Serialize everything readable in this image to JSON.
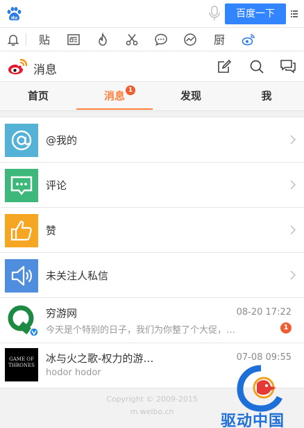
{
  "browser": {
    "search_button": "百度一下"
  },
  "header": {
    "title": "消息"
  },
  "tabs": [
    {
      "label": "首页"
    },
    {
      "label": "消息",
      "badge": "1"
    },
    {
      "label": "发现"
    },
    {
      "label": "我"
    }
  ],
  "list": [
    {
      "label": "@我的",
      "icon": "at-icon",
      "color": "#54b2d6"
    },
    {
      "label": "评论",
      "icon": "comment-icon",
      "color": "#3db87a"
    },
    {
      "label": "赞",
      "icon": "thumbs-up-icon",
      "color": "#f5a623"
    },
    {
      "label": "未关注人私信",
      "icon": "speaker-icon",
      "color": "#4f8ddf"
    }
  ],
  "messages": [
    {
      "name": "穷游网",
      "time": "08-20 17:22",
      "preview": "今天是个特别的日子，我们为你整了个大促，…",
      "badge": "1"
    },
    {
      "name": "冰与火之歌-权力的游…",
      "time": "07-08 09:55",
      "preview": "hodor hodor",
      "avatar_text": "GAME OF THRONES"
    }
  ],
  "footer": {
    "copyright": "Copyright © 2009-2015",
    "domain": "m.weibo.cn"
  },
  "watermark": {
    "text": "驱动中国"
  },
  "colors": {
    "accent": "#ff8140",
    "badge": "#ef5d32",
    "search_button": "#3385ff"
  }
}
